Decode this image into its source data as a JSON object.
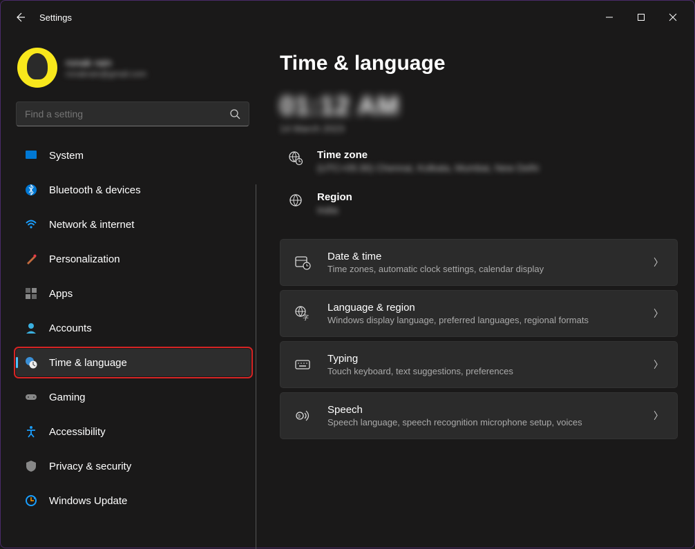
{
  "app": {
    "title": "Settings"
  },
  "profile": {
    "name": "ronak rain",
    "email": "ronakrain@gmail.com"
  },
  "search": {
    "placeholder": "Find a setting"
  },
  "sidebar": {
    "items": [
      {
        "label": "System",
        "icon": "system"
      },
      {
        "label": "Bluetooth & devices",
        "icon": "bluetooth"
      },
      {
        "label": "Network & internet",
        "icon": "wifi"
      },
      {
        "label": "Personalization",
        "icon": "brush"
      },
      {
        "label": "Apps",
        "icon": "apps"
      },
      {
        "label": "Accounts",
        "icon": "account"
      },
      {
        "label": "Time & language",
        "icon": "clock"
      },
      {
        "label": "Gaming",
        "icon": "game"
      },
      {
        "label": "Accessibility",
        "icon": "access"
      },
      {
        "label": "Privacy & security",
        "icon": "shield"
      },
      {
        "label": "Windows Update",
        "icon": "update"
      }
    ],
    "selected_index": 6
  },
  "page": {
    "title": "Time & language",
    "time": "01:12 AM",
    "date": "14 March 2023",
    "info": {
      "timezone": {
        "label": "Time zone",
        "value": "(UTC+05:30) Chennai, Kolkata, Mumbai, New Delhi"
      },
      "region": {
        "label": "Region",
        "value": "India"
      }
    },
    "cards": [
      {
        "title": "Date & time",
        "desc": "Time zones, automatic clock settings, calendar display",
        "icon": "datetime"
      },
      {
        "title": "Language & region",
        "desc": "Windows display language, preferred languages, regional formats",
        "icon": "langregion"
      },
      {
        "title": "Typing",
        "desc": "Touch keyboard, text suggestions, preferences",
        "icon": "keyboard"
      },
      {
        "title": "Speech",
        "desc": "Speech language, speech recognition microphone setup, voices",
        "icon": "speech"
      }
    ]
  }
}
